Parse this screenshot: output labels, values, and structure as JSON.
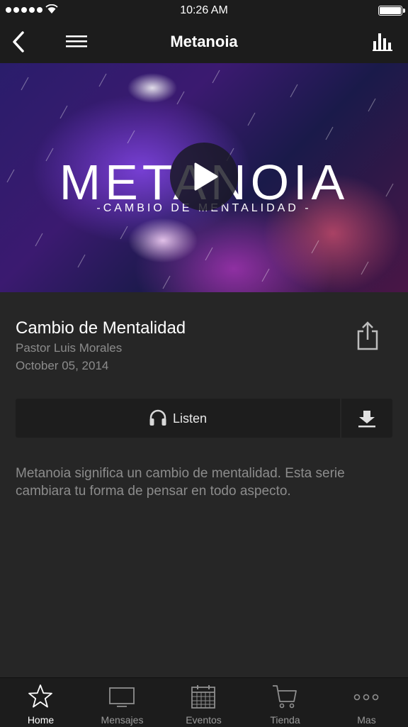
{
  "status_bar": {
    "time": "10:26 AM"
  },
  "nav": {
    "title": "Metanoia"
  },
  "hero": {
    "title": "METANOIA",
    "subtitle": "-CAMBIO DE MENTALIDAD -"
  },
  "message": {
    "title": "Cambio de Mentalidad",
    "speaker": "Pastor Luis Morales",
    "date": "October 05, 2014"
  },
  "actions": {
    "listen_label": "Listen"
  },
  "description": "Metanoia significa un cambio de mentalidad. Esta serie cambiara tu forma de pensar en todo aspecto.",
  "tabs": [
    {
      "label": "Home",
      "icon": "star-icon",
      "active": true
    },
    {
      "label": "Mensajes",
      "icon": "tv-icon"
    },
    {
      "label": "Eventos",
      "icon": "calendar-icon"
    },
    {
      "label": "Tienda",
      "icon": "cart-icon"
    },
    {
      "label": "Mas",
      "icon": "more-icon"
    }
  ],
  "colors": {
    "background": "#262626",
    "bar": "#1c1c1c",
    "muted_text": "#8c8c8c"
  }
}
